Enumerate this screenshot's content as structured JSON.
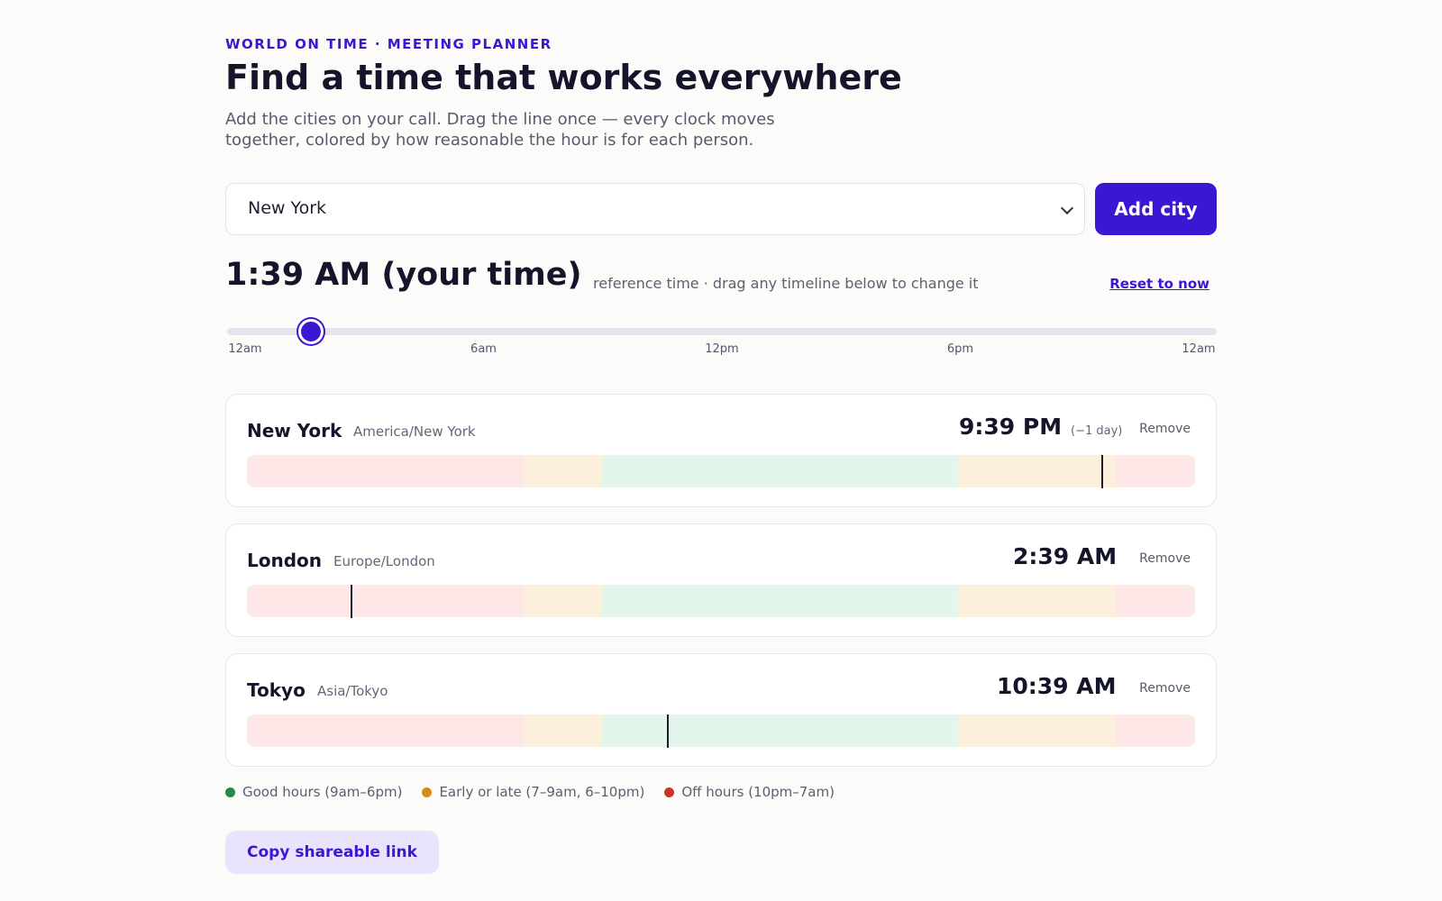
{
  "header": {
    "eyebrow": "WORLD ON TIME · MEETING PLANNER",
    "title": "Find a time that works everywhere",
    "subtitle": "Add the cities on your call. Drag the line once — every clock moves together, colored by how reasonable the hour is for each person."
  },
  "picker": {
    "selected_city": "New York",
    "add_label": "Add city"
  },
  "reference": {
    "time": "1:39 AM (your time)",
    "note": "reference time · drag any timeline below to change it",
    "reset_label": "Reset to now",
    "slider_hour": 1.65,
    "ticks": [
      "12am",
      "6am",
      "12pm",
      "6pm",
      "12am"
    ]
  },
  "cities": [
    {
      "name": "New York",
      "zone": "America/New York",
      "time": "9:39 PM",
      "day_diff": "(−1 day)",
      "remove_label": "Remove",
      "local_hour": 21.65
    },
    {
      "name": "London",
      "zone": "Europe/London",
      "time": "2:39 AM",
      "day_diff": "",
      "remove_label": "Remove",
      "local_hour": 2.65
    },
    {
      "name": "Tokyo",
      "zone": "Asia/Tokyo",
      "time": "10:39 AM",
      "day_diff": "",
      "remove_label": "Remove",
      "local_hour": 10.65
    }
  ],
  "hour_bands": [
    {
      "kind": "off",
      "from": 0,
      "to": 7
    },
    {
      "kind": "edge",
      "from": 7,
      "to": 9
    },
    {
      "kind": "good",
      "from": 9,
      "to": 18
    },
    {
      "kind": "edge",
      "from": 18,
      "to": 22
    },
    {
      "kind": "off",
      "from": 22,
      "to": 24
    }
  ],
  "legend": [
    {
      "label": "Good hours (9am–6pm)",
      "color": "#1e8a4c"
    },
    {
      "label": "Early or late (7–9am, 6–10pm)",
      "color": "#d98a14"
    },
    {
      "label": "Off hours (10pm–7am)",
      "color": "#c9342b"
    }
  ],
  "copy_label": "Copy shareable link"
}
